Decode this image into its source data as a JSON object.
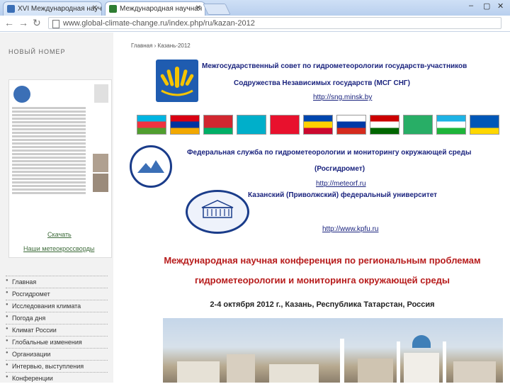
{
  "browser": {
    "tabs": [
      {
        "title": "XVI Международная научная",
        "active": false
      },
      {
        "title": "Международная научная",
        "active": true
      }
    ],
    "url": "www.global-climate-change.ru/index.php/ru/kazan-2012",
    "window_controls": [
      "–",
      "▢",
      "✕"
    ]
  },
  "sidebar": {
    "heading": "НОВЫЙ НОМЕР",
    "download_link": "Скачать",
    "archive_link": "Наши метеокроссворды",
    "menu": [
      "Главная",
      "Росгидромет",
      "Исследования климата",
      "Погода дня",
      "Климат России",
      "Глобальные изменения",
      "Организации",
      "Интервью, выступления",
      "Конференции"
    ]
  },
  "main": {
    "breadcrumb": "Главная  ›  Казань-2012",
    "cis_title_1": "Межгосударственный совет по гидрометеорологии государств-участников",
    "cis_title_2": "Содружества Независимых государств (МСГ СНГ)",
    "cis_link": "http://sng.minsk.by",
    "flags": [
      {
        "name": "azerbaijan",
        "colors": [
          "#00b5e2",
          "#ef3340",
          "#509e2f"
        ]
      },
      {
        "name": "armenia",
        "colors": [
          "#d90012",
          "#0033a0",
          "#f2a800"
        ]
      },
      {
        "name": "belarus",
        "colors": [
          "#d22730",
          "#d22730",
          "#00af66"
        ]
      },
      {
        "name": "kazakhstan",
        "colors": [
          "#00afca",
          "#00afca",
          "#00afca"
        ]
      },
      {
        "name": "kyrgyzstan",
        "colors": [
          "#e8112d",
          "#e8112d",
          "#e8112d"
        ]
      },
      {
        "name": "moldova",
        "colors": [
          "#0046ae",
          "#ffd200",
          "#cc092f"
        ]
      },
      {
        "name": "russia",
        "colors": [
          "#ffffff",
          "#0039a6",
          "#d52b1e"
        ]
      },
      {
        "name": "tajikistan",
        "colors": [
          "#cc0000",
          "#ffffff",
          "#006600"
        ]
      },
      {
        "name": "turkmenistan",
        "colors": [
          "#28ae66",
          "#28ae66",
          "#28ae66"
        ]
      },
      {
        "name": "uzbekistan",
        "colors": [
          "#1eb3e5",
          "#ffffff",
          "#1eb53a"
        ]
      },
      {
        "name": "ukraine",
        "colors": [
          "#0057b7",
          "#0057b7",
          "#ffd700"
        ]
      }
    ],
    "ros_title_1": "Федеральная служба по гидрометеорологии и мониторингу окружающей среды",
    "ros_title_2": "(Росгидромет)",
    "ros_link": "http://meteorf.ru",
    "kfu_title": "Казанский (Приволжский) федеральный университет",
    "kfu_link": "http://www.kpfu.ru",
    "conf_line_1": "Международная научная конференция по региональным проблемам",
    "conf_line_2": "гидрометеорологии и мониторинга окружающей среды",
    "conf_date": "2-4 октября 2012 г., Казань, Республика Татарстан, Россия"
  }
}
